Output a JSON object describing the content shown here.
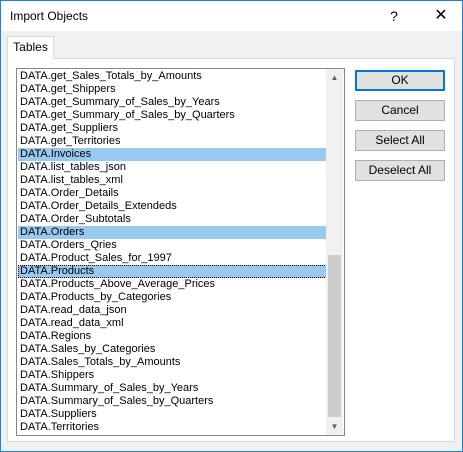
{
  "window": {
    "title": "Import Objects",
    "help_label": "?",
    "close_label": "✕"
  },
  "tabs": [
    {
      "label": "Tables"
    }
  ],
  "list": {
    "items": [
      {
        "label": "DATA.get_Sales_Totals_by_Amounts",
        "selected": false
      },
      {
        "label": "DATA.get_Shippers",
        "selected": false
      },
      {
        "label": "DATA.get_Summary_of_Sales_by_Years",
        "selected": false
      },
      {
        "label": "DATA.get_Summary_of_Sales_by_Quarters",
        "selected": false
      },
      {
        "label": "DATA.get_Suppliers",
        "selected": false
      },
      {
        "label": "DATA.get_Territories",
        "selected": false
      },
      {
        "label": "DATA.Invoices",
        "selected": true
      },
      {
        "label": "DATA.list_tables_json",
        "selected": false
      },
      {
        "label": "DATA.list_tables_xml",
        "selected": false
      },
      {
        "label": "DATA.Order_Details",
        "selected": false
      },
      {
        "label": "DATA.Order_Details_Extendeds",
        "selected": false
      },
      {
        "label": "DATA.Order_Subtotals",
        "selected": false
      },
      {
        "label": "DATA.Orders",
        "selected": true
      },
      {
        "label": "DATA.Orders_Qries",
        "selected": false
      },
      {
        "label": "DATA.Product_Sales_for_1997",
        "selected": false
      },
      {
        "label": "DATA.Products",
        "selected": true,
        "focused": true
      },
      {
        "label": "DATA.Products_Above_Average_Prices",
        "selected": false
      },
      {
        "label": "DATA.Products_by_Categories",
        "selected": false
      },
      {
        "label": "DATA.read_data_json",
        "selected": false
      },
      {
        "label": "DATA.read_data_xml",
        "selected": false
      },
      {
        "label": "DATA.Regions",
        "selected": false
      },
      {
        "label": "DATA.Sales_by_Categories",
        "selected": false
      },
      {
        "label": "DATA.Sales_Totals_by_Amounts",
        "selected": false
      },
      {
        "label": "DATA.Shippers",
        "selected": false
      },
      {
        "label": "DATA.Summary_of_Sales_by_Years",
        "selected": false
      },
      {
        "label": "DATA.Summary_of_Sales_by_Quarters",
        "selected": false
      },
      {
        "label": "DATA.Suppliers",
        "selected": false
      },
      {
        "label": "DATA.Territories",
        "selected": false
      }
    ]
  },
  "scrollbar": {
    "up_icon": "triangle-up",
    "down_icon": "triangle-down"
  },
  "buttons": {
    "ok": "OK",
    "cancel": "Cancel",
    "select_all": "Select All",
    "deselect_all": "Deselect All"
  },
  "colors": {
    "selection": "#99c9ef",
    "accent": "#0078d7",
    "window_border": "#1883d7"
  }
}
